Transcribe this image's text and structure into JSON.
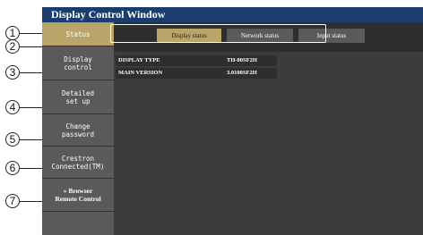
{
  "window": {
    "title": "Display Control Window"
  },
  "sidebar": {
    "items": [
      {
        "label": "Status",
        "active": true
      },
      {
        "label": "Display\ncontrol",
        "active": false
      },
      {
        "label": "Detailed\nset up",
        "active": false
      },
      {
        "label": "Change\npassword",
        "active": false
      },
      {
        "label": "Crestron\nConnected(TM)",
        "active": false
      },
      {
        "label": "» Browser\nRemote Control",
        "active": false
      }
    ]
  },
  "tabs": [
    {
      "label": "Display status",
      "active": true
    },
    {
      "label": "Network status",
      "active": false
    },
    {
      "label": "Input status",
      "active": false
    }
  ],
  "info": {
    "rows": [
      {
        "key": "DISPLAY TYPE",
        "value": "TH-80SF2H"
      },
      {
        "key": "MAIN VERSION",
        "value": "3.0100SF2H"
      }
    ]
  },
  "callouts": [
    "1",
    "2",
    "3",
    "4",
    "5",
    "6",
    "7"
  ],
  "colors": {
    "title_bar": "#1b3d6e",
    "active_accent": "#b9a56a",
    "sidebar_item": "#5a5a5a",
    "background": "#3c3c3c"
  }
}
